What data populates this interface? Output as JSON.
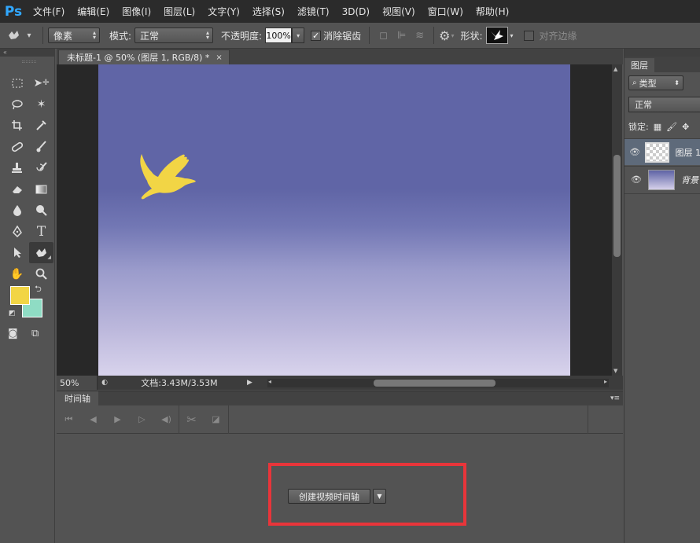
{
  "app": {
    "logo": "Ps"
  },
  "menu": [
    "文件(F)",
    "编辑(E)",
    "图像(I)",
    "图层(L)",
    "文字(Y)",
    "选择(S)",
    "滤镜(T)",
    "3D(D)",
    "视图(V)",
    "窗口(W)",
    "帮助(H)"
  ],
  "options": {
    "tool_mode": "像素",
    "mode_label": "模式:",
    "mode_value": "正常",
    "opacity_label": "不透明度:",
    "opacity_value": "100%",
    "antialias_label": "消除锯齿",
    "antialias_checked": true,
    "shape_label": "形状:",
    "align_edges_label": "对齐边缘",
    "align_edges_checked": false
  },
  "document": {
    "tab_title": "未标题-1 @ 50% (图层 1, RGB/8) *",
    "close_glyph": "×"
  },
  "status": {
    "zoom": "50%",
    "doc_info": "文档:3.43M/3.53M"
  },
  "timeline": {
    "tab_label": "时间轴",
    "create_button": "创建视频时间轴"
  },
  "layers_panel": {
    "tab_label": "图层",
    "filter_label": "类型",
    "blend_mode": "正常",
    "lock_label": "锁定:",
    "layers": [
      {
        "name": "图层 1",
        "selected": true
      },
      {
        "name": "背景",
        "selected": false
      }
    ]
  },
  "colors": {
    "foreground": "#f2d545",
    "background": "#8fdcc4",
    "bird": "#f2d545",
    "highlight": "#e8353a",
    "sky_top": "#6065a6",
    "sky_bottom": "#d8d3ec"
  }
}
